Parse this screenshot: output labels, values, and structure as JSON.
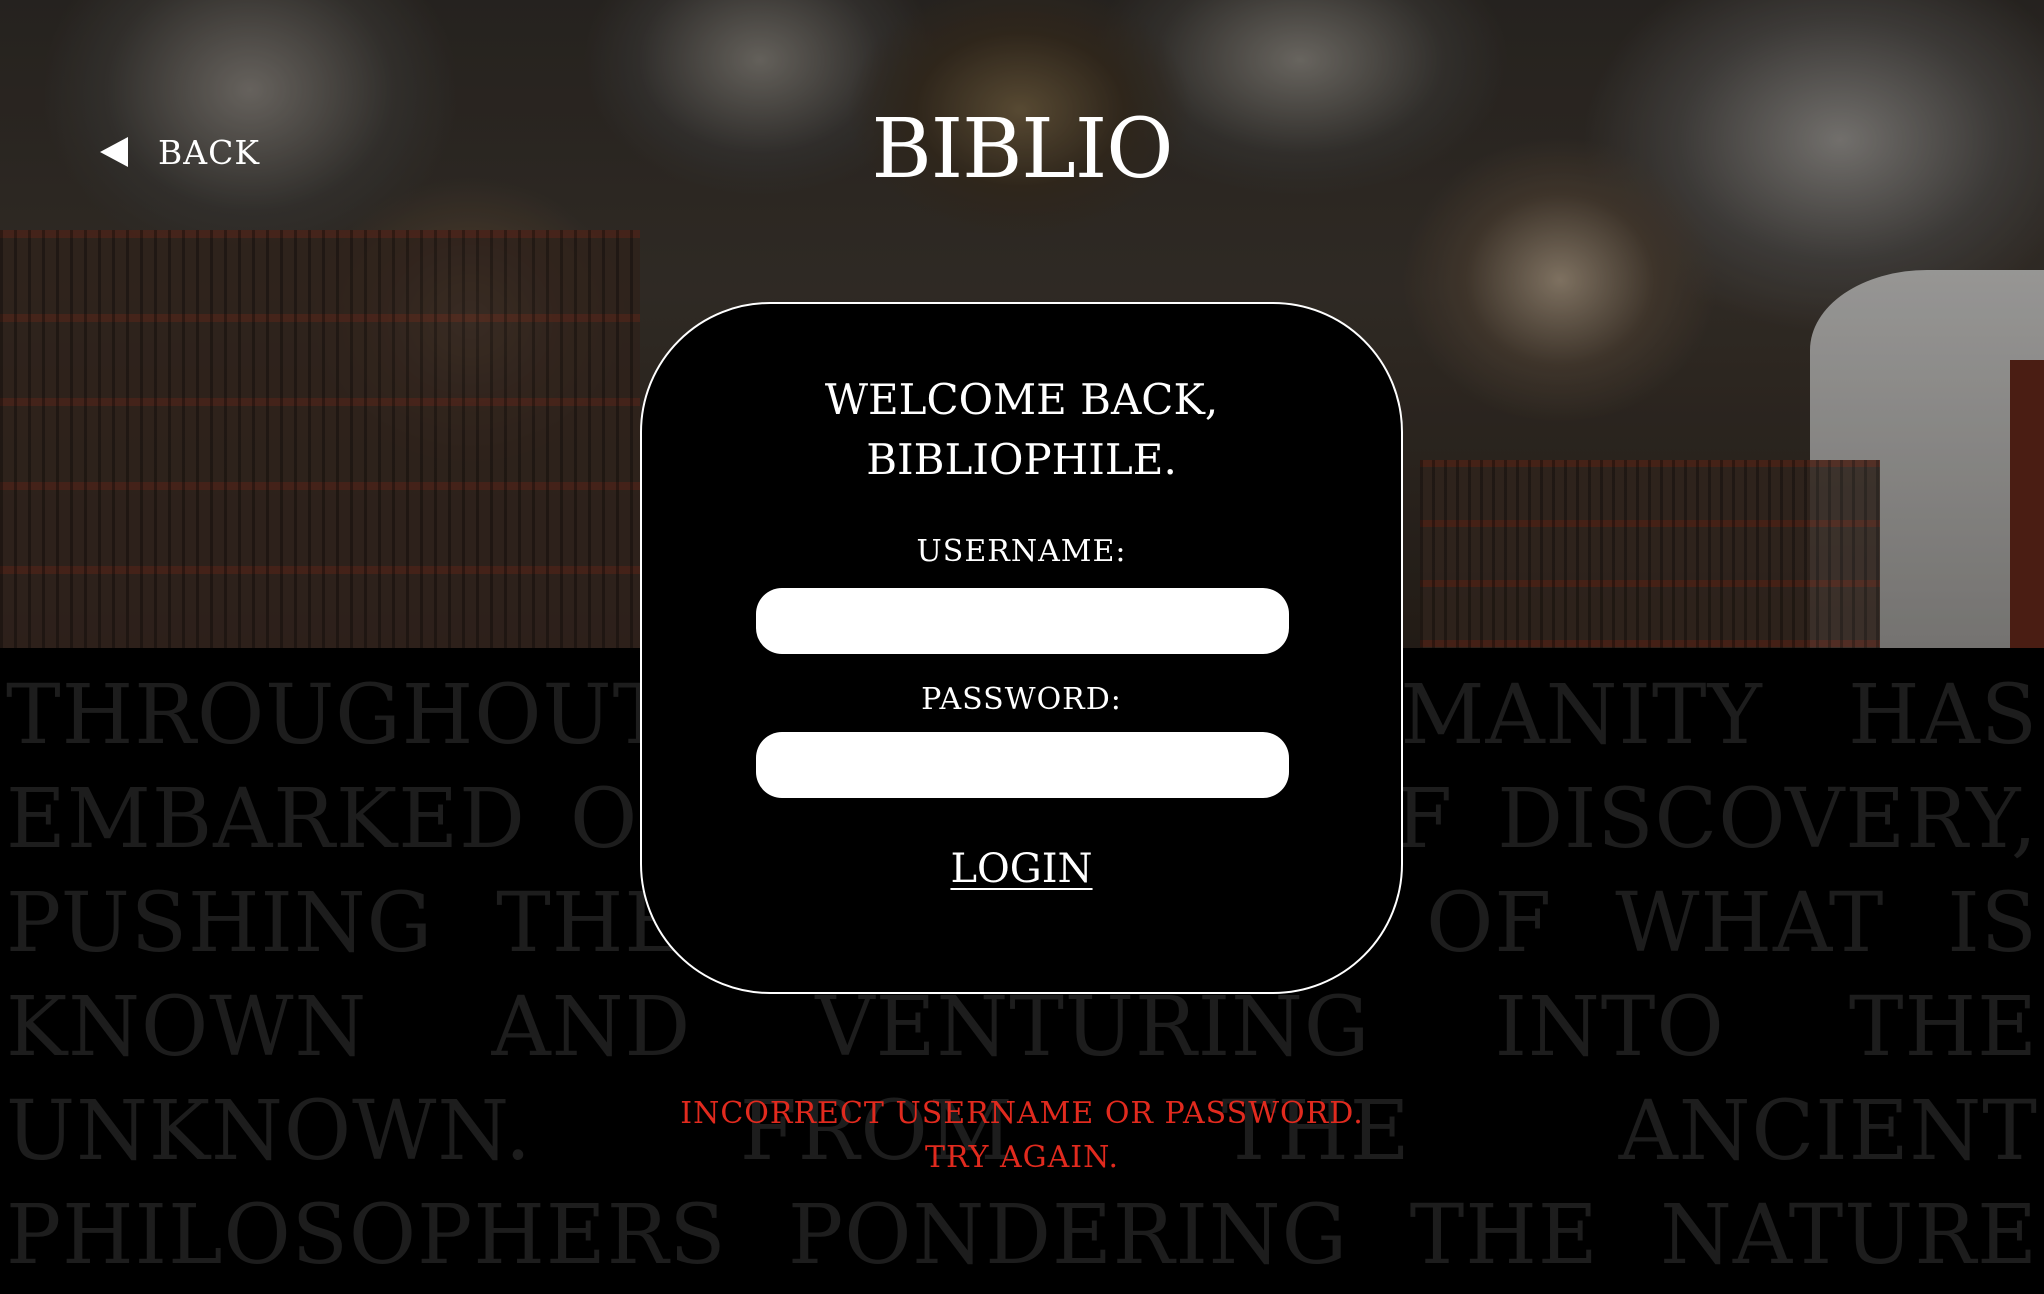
{
  "header": {
    "back_label": "BACK",
    "logo": "BIBLIO"
  },
  "backdrop": {
    "text": "THROUGHOUT HISTORY, HUMANITY HAS EMBARKED ON A JOURNEY OF DISCOVERY, PUSHING THE BOUNDARIES OF WHAT IS KNOWN AND VENTURING INTO THE UNKNOWN. FROM THE ANCIENT PHILOSOPHERS PONDERING THE NATURE OF EXISTENCE TO THE MODERN SCIENTISTS PROBING THE DEPTHS OF QUANTUM MECHANICS, EACH GENERATION BUILDS UPON THE KNOWLEDGE"
  },
  "login": {
    "heading_line1": "WELCOME BACK,",
    "heading_line2": "BIBLIOPHILE.",
    "username_label": "USERNAME:",
    "username_value": "",
    "password_label": "PASSWORD:",
    "password_value": "",
    "login_label": "LOGIN"
  },
  "error": {
    "line1": "INCORRECT USERNAME OR PASSWORD.",
    "line2": "TRY AGAIN."
  },
  "colors": {
    "background": "#000000",
    "error": "#e12a1e",
    "text": "#ffffff"
  }
}
